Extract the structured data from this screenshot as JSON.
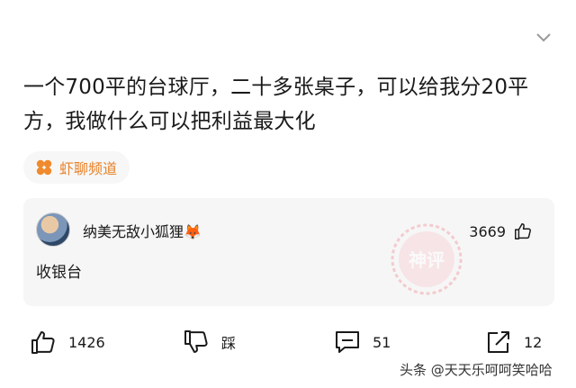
{
  "post": {
    "title": "一个700平的台球厅，二十多张桌子，可以给我分20平方，我做什么可以把利益最大化"
  },
  "channel": {
    "label": "虾聊频道",
    "icon": "clover-icon",
    "color": "#e8832a"
  },
  "top_comment": {
    "username": "纳美无敌小狐狸",
    "emoji": "🦊",
    "likes": "3669",
    "text": "收银台",
    "stamp": "神评"
  },
  "actions": {
    "like_count": "1426",
    "dislike_label": "踩",
    "comment_count": "51",
    "share_count": "12"
  },
  "watermark": "头条 @天天乐呵呵笑哈哈"
}
